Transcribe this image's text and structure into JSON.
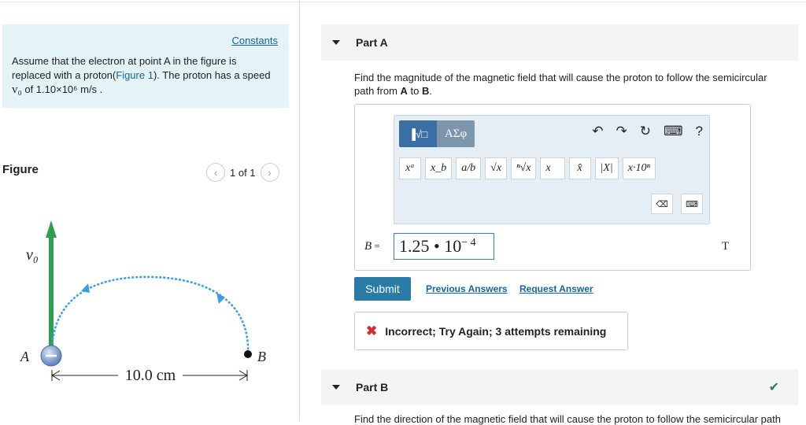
{
  "intro": {
    "constants_link": "Constants",
    "line1": "Assume that the electron at point A in the figure is",
    "line2_pre": "replaced with a proton(",
    "figure_link": "Figure 1",
    "line2_post": "). The proton has a speed",
    "v0_symbol": "v₀",
    "v0_text": " of 1.10×10⁶ m/s ."
  },
  "figure": {
    "label": "Figure",
    "pager_text": "1 of 1",
    "prev_icon": "‹",
    "next_icon": "›",
    "v0_label": "v₀",
    "a_label": "A",
    "b_label": "B",
    "distance_label": "10.0 cm",
    "colors": {
      "velocity_arrow": "#2e9e4f",
      "path": "#3a9fe0",
      "particle": "#6b8fc7"
    }
  },
  "part_a": {
    "title": "Part A",
    "question_pre": "Find the magnitude of the magnetic field that will cause the proton to follow the semicircular path from ",
    "point_a": "A",
    "question_mid": " to ",
    "point_b": "B",
    "question_end": ".",
    "toolbar": {
      "template_label": "▐√□",
      "greek_label": "ΑΣφ",
      "undo": "↶",
      "redo": "↷",
      "reset": "↻",
      "keyboard": "⌨",
      "help": "?",
      "buttons": [
        "xᵃ",
        "x_b",
        "a/b",
        "√x",
        "ⁿ√x",
        "x⃗",
        "x̂",
        "|X|",
        "x·10ⁿ"
      ],
      "delete": "⌫",
      "keypad": "⌨"
    },
    "variable": "B",
    "equals": "=",
    "answer_mantissa": "1.25 • 10",
    "answer_exponent": "− 4",
    "unit": "T",
    "submit_label": "Submit",
    "previous_answers": "Previous Answers",
    "request_answer": "Request Answer",
    "feedback": "Incorrect; Try Again; 3 attempts remaining",
    "feedback_icon": "✖"
  },
  "part_b": {
    "title": "Part B",
    "status_icon": "✔",
    "question": "Find the direction of the magnetic field that will cause the proton to follow the semicircular path"
  }
}
